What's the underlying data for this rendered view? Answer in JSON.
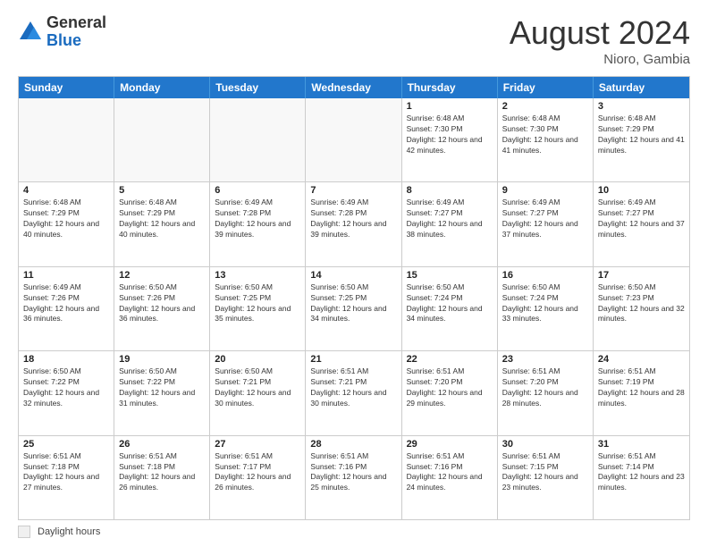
{
  "header": {
    "logo_general": "General",
    "logo_blue": "Blue",
    "month_year": "August 2024",
    "location": "Nioro, Gambia"
  },
  "calendar": {
    "days_of_week": [
      "Sunday",
      "Monday",
      "Tuesday",
      "Wednesday",
      "Thursday",
      "Friday",
      "Saturday"
    ],
    "weeks": [
      [
        {
          "day": "",
          "empty": true
        },
        {
          "day": "",
          "empty": true
        },
        {
          "day": "",
          "empty": true
        },
        {
          "day": "",
          "empty": true
        },
        {
          "day": "1",
          "sunrise": "6:48 AM",
          "sunset": "7:30 PM",
          "daylight": "12 hours and 42 minutes."
        },
        {
          "day": "2",
          "sunrise": "6:48 AM",
          "sunset": "7:30 PM",
          "daylight": "12 hours and 41 minutes."
        },
        {
          "day": "3",
          "sunrise": "6:48 AM",
          "sunset": "7:29 PM",
          "daylight": "12 hours and 41 minutes."
        }
      ],
      [
        {
          "day": "4",
          "sunrise": "6:48 AM",
          "sunset": "7:29 PM",
          "daylight": "12 hours and 40 minutes."
        },
        {
          "day": "5",
          "sunrise": "6:48 AM",
          "sunset": "7:29 PM",
          "daylight": "12 hours and 40 minutes."
        },
        {
          "day": "6",
          "sunrise": "6:49 AM",
          "sunset": "7:28 PM",
          "daylight": "12 hours and 39 minutes."
        },
        {
          "day": "7",
          "sunrise": "6:49 AM",
          "sunset": "7:28 PM",
          "daylight": "12 hours and 39 minutes."
        },
        {
          "day": "8",
          "sunrise": "6:49 AM",
          "sunset": "7:27 PM",
          "daylight": "12 hours and 38 minutes."
        },
        {
          "day": "9",
          "sunrise": "6:49 AM",
          "sunset": "7:27 PM",
          "daylight": "12 hours and 37 minutes."
        },
        {
          "day": "10",
          "sunrise": "6:49 AM",
          "sunset": "7:27 PM",
          "daylight": "12 hours and 37 minutes."
        }
      ],
      [
        {
          "day": "11",
          "sunrise": "6:49 AM",
          "sunset": "7:26 PM",
          "daylight": "12 hours and 36 minutes."
        },
        {
          "day": "12",
          "sunrise": "6:50 AM",
          "sunset": "7:26 PM",
          "daylight": "12 hours and 36 minutes."
        },
        {
          "day": "13",
          "sunrise": "6:50 AM",
          "sunset": "7:25 PM",
          "daylight": "12 hours and 35 minutes."
        },
        {
          "day": "14",
          "sunrise": "6:50 AM",
          "sunset": "7:25 PM",
          "daylight": "12 hours and 34 minutes."
        },
        {
          "day": "15",
          "sunrise": "6:50 AM",
          "sunset": "7:24 PM",
          "daylight": "12 hours and 34 minutes."
        },
        {
          "day": "16",
          "sunrise": "6:50 AM",
          "sunset": "7:24 PM",
          "daylight": "12 hours and 33 minutes."
        },
        {
          "day": "17",
          "sunrise": "6:50 AM",
          "sunset": "7:23 PM",
          "daylight": "12 hours and 32 minutes."
        }
      ],
      [
        {
          "day": "18",
          "sunrise": "6:50 AM",
          "sunset": "7:22 PM",
          "daylight": "12 hours and 32 minutes."
        },
        {
          "day": "19",
          "sunrise": "6:50 AM",
          "sunset": "7:22 PM",
          "daylight": "12 hours and 31 minutes."
        },
        {
          "day": "20",
          "sunrise": "6:50 AM",
          "sunset": "7:21 PM",
          "daylight": "12 hours and 30 minutes."
        },
        {
          "day": "21",
          "sunrise": "6:51 AM",
          "sunset": "7:21 PM",
          "daylight": "12 hours and 30 minutes."
        },
        {
          "day": "22",
          "sunrise": "6:51 AM",
          "sunset": "7:20 PM",
          "daylight": "12 hours and 29 minutes."
        },
        {
          "day": "23",
          "sunrise": "6:51 AM",
          "sunset": "7:20 PM",
          "daylight": "12 hours and 28 minutes."
        },
        {
          "day": "24",
          "sunrise": "6:51 AM",
          "sunset": "7:19 PM",
          "daylight": "12 hours and 28 minutes."
        }
      ],
      [
        {
          "day": "25",
          "sunrise": "6:51 AM",
          "sunset": "7:18 PM",
          "daylight": "12 hours and 27 minutes."
        },
        {
          "day": "26",
          "sunrise": "6:51 AM",
          "sunset": "7:18 PM",
          "daylight": "12 hours and 26 minutes."
        },
        {
          "day": "27",
          "sunrise": "6:51 AM",
          "sunset": "7:17 PM",
          "daylight": "12 hours and 26 minutes."
        },
        {
          "day": "28",
          "sunrise": "6:51 AM",
          "sunset": "7:16 PM",
          "daylight": "12 hours and 25 minutes."
        },
        {
          "day": "29",
          "sunrise": "6:51 AM",
          "sunset": "7:16 PM",
          "daylight": "12 hours and 24 minutes."
        },
        {
          "day": "30",
          "sunrise": "6:51 AM",
          "sunset": "7:15 PM",
          "daylight": "12 hours and 23 minutes."
        },
        {
          "day": "31",
          "sunrise": "6:51 AM",
          "sunset": "7:14 PM",
          "daylight": "12 hours and 23 minutes."
        }
      ]
    ]
  },
  "footer": {
    "legend_label": "Daylight hours"
  }
}
